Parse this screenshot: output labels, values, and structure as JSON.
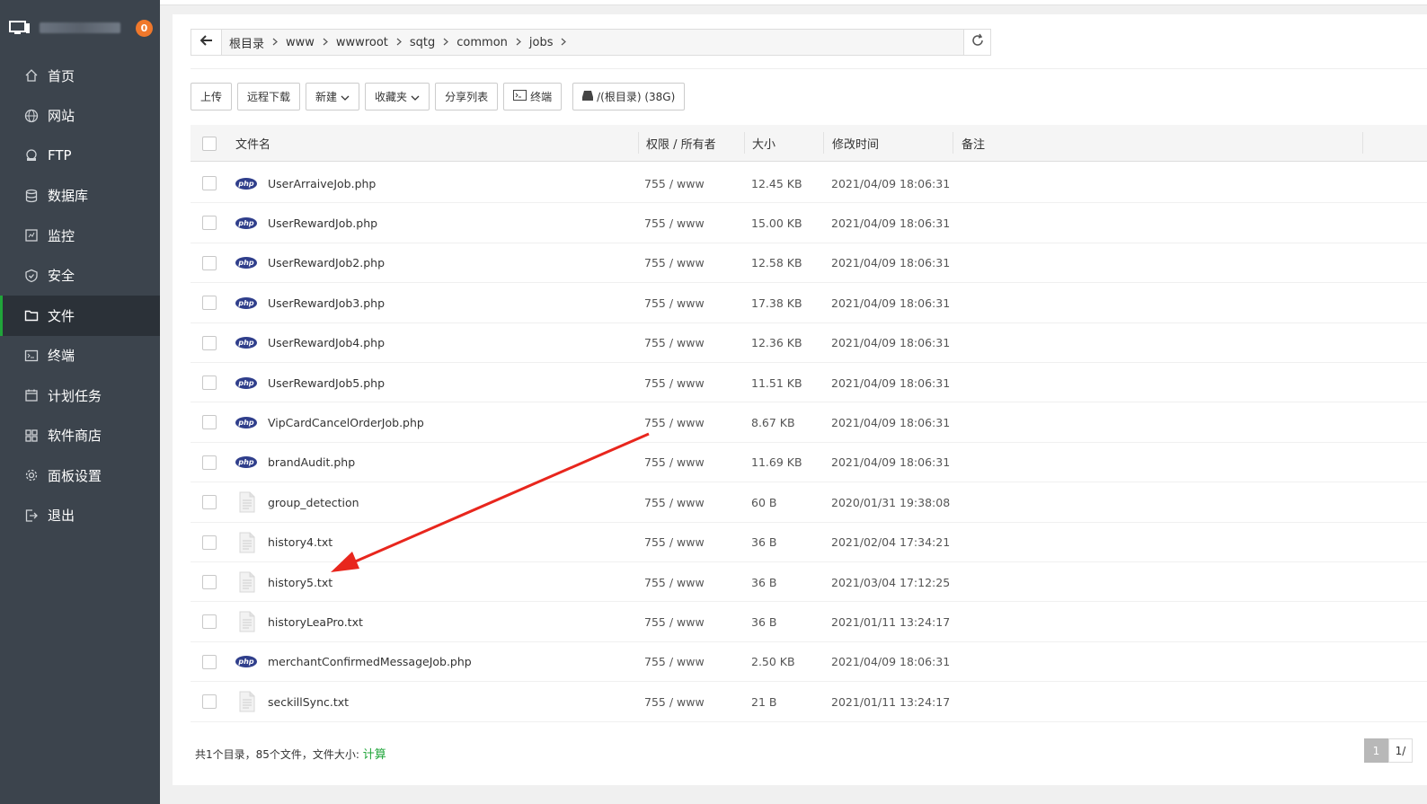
{
  "header": {
    "notification_count": "0"
  },
  "sidebar": {
    "items": [
      {
        "label": "首页",
        "icon": "home-icon"
      },
      {
        "label": "网站",
        "icon": "globe-icon"
      },
      {
        "label": "FTP",
        "icon": "ftp-icon"
      },
      {
        "label": "数据库",
        "icon": "database-icon"
      },
      {
        "label": "监控",
        "icon": "monitor-icon"
      },
      {
        "label": "安全",
        "icon": "shield-icon"
      },
      {
        "label": "文件",
        "icon": "folder-icon",
        "active": true
      },
      {
        "label": "终端",
        "icon": "terminal-icon"
      },
      {
        "label": "计划任务",
        "icon": "calendar-icon"
      },
      {
        "label": "软件商店",
        "icon": "grid-icon"
      },
      {
        "label": "面板设置",
        "icon": "gear-icon"
      },
      {
        "label": "退出",
        "icon": "logout-icon"
      }
    ]
  },
  "path": {
    "crumbs": [
      "根目录",
      "www",
      "wwwroot",
      "sqtg",
      "common",
      "jobs"
    ]
  },
  "toolbar": {
    "upload": "上传",
    "remote_download": "远程下载",
    "new": "新建",
    "favorites": "收藏夹",
    "share_list": "分享列表",
    "terminal": "终端",
    "disk": "/(根目录) (38G)"
  },
  "table": {
    "headers": {
      "name": "文件名",
      "perm": "权限 / 所有者",
      "size": "大小",
      "mtime": "修改时间",
      "note": "备注"
    },
    "rows": [
      {
        "name": "UserArraiveJob.php",
        "type": "php",
        "perm": "755 / www",
        "size": "12.45 KB",
        "mtime": "2021/04/09 18:06:31"
      },
      {
        "name": "UserRewardJob.php",
        "type": "php",
        "perm": "755 / www",
        "size": "15.00 KB",
        "mtime": "2021/04/09 18:06:31"
      },
      {
        "name": "UserRewardJob2.php",
        "type": "php",
        "perm": "755 / www",
        "size": "12.58 KB",
        "mtime": "2021/04/09 18:06:31"
      },
      {
        "name": "UserRewardJob3.php",
        "type": "php",
        "perm": "755 / www",
        "size": "17.38 KB",
        "mtime": "2021/04/09 18:06:31"
      },
      {
        "name": "UserRewardJob4.php",
        "type": "php",
        "perm": "755 / www",
        "size": "12.36 KB",
        "mtime": "2021/04/09 18:06:31"
      },
      {
        "name": "UserRewardJob5.php",
        "type": "php",
        "perm": "755 / www",
        "size": "11.51 KB",
        "mtime": "2021/04/09 18:06:31"
      },
      {
        "name": "VipCardCancelOrderJob.php",
        "type": "php",
        "perm": "755 / www",
        "size": "8.67 KB",
        "mtime": "2021/04/09 18:06:31"
      },
      {
        "name": "brandAudit.php",
        "type": "php",
        "perm": "755 / www",
        "size": "11.69 KB",
        "mtime": "2021/04/09 18:06:31"
      },
      {
        "name": "group_detection",
        "type": "file",
        "perm": "755 / www",
        "size": "60 B",
        "mtime": "2020/01/31 19:38:08"
      },
      {
        "name": "history4.txt",
        "type": "file",
        "perm": "755 / www",
        "size": "36 B",
        "mtime": "2021/02/04 17:34:21"
      },
      {
        "name": "history5.txt",
        "type": "file",
        "perm": "755 / www",
        "size": "36 B",
        "mtime": "2021/03/04 17:12:25"
      },
      {
        "name": "historyLeaPro.txt",
        "type": "file",
        "perm": "755 / www",
        "size": "36 B",
        "mtime": "2021/01/11 13:24:17"
      },
      {
        "name": "merchantConfirmedMessageJob.php",
        "type": "php",
        "perm": "755 / www",
        "size": "2.50 KB",
        "mtime": "2021/04/09 18:06:31"
      },
      {
        "name": "seckillSync.txt",
        "type": "file",
        "perm": "755 / www",
        "size": "21 B",
        "mtime": "2021/01/11 13:24:17"
      }
    ]
  },
  "footer": {
    "summary": "共1个目录，85个文件，文件大小: ",
    "calc_link": "计算",
    "current_page": "1",
    "page_info": "1/"
  },
  "colors": {
    "sidebar_bg": "#3c444d",
    "accent_green": "#20a53a",
    "badge_orange": "#f0782b",
    "annotation_red": "#e8261d"
  }
}
